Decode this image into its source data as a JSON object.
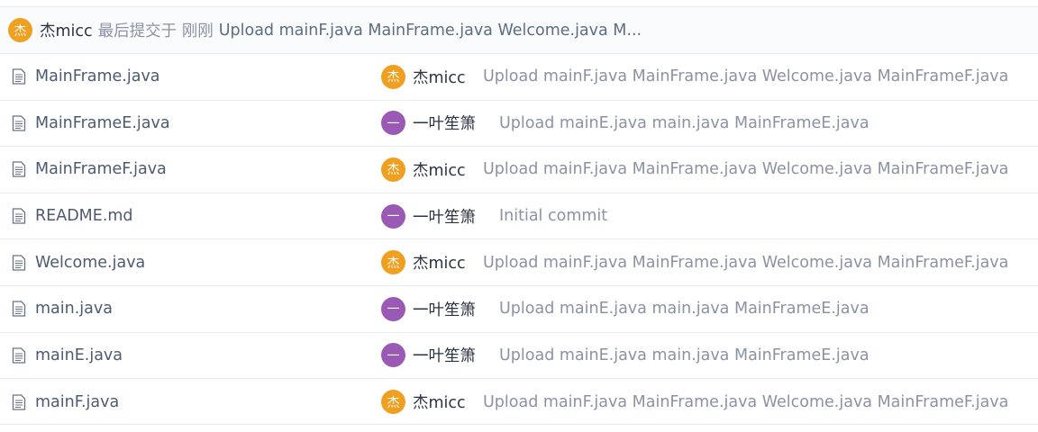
{
  "latest_commit": {
    "avatar_char": "杰",
    "author": "杰micc",
    "meta": "最后提交于 刚刚",
    "message": "Upload mainF.java MainFrame.java Welcome.java M..."
  },
  "files": [
    {
      "name": "MainFrame.java",
      "avatar_char": "杰",
      "author": "杰micc",
      "message": "Upload mainF.java MainFrame.java Welcome.java MainFrameF.java"
    },
    {
      "name": "MainFrameE.java",
      "avatar_char": "一",
      "author": "一叶笙箫",
      "message": "Upload mainE.java main.java MainFrameE.java"
    },
    {
      "name": "MainFrameF.java",
      "avatar_char": "杰",
      "author": "杰micc",
      "message": "Upload mainF.java MainFrame.java Welcome.java MainFrameF.java"
    },
    {
      "name": "README.md",
      "avatar_char": "一",
      "author": "一叶笙箫",
      "message": "Initial commit"
    },
    {
      "name": "Welcome.java",
      "avatar_char": "杰",
      "author": "杰micc",
      "message": "Upload mainF.java MainFrame.java Welcome.java MainFrameF.java"
    },
    {
      "name": "main.java",
      "avatar_char": "一",
      "author": "一叶笙箫",
      "message": "Upload mainE.java main.java MainFrameE.java"
    },
    {
      "name": "mainE.java",
      "avatar_char": "一",
      "author": "一叶笙箫",
      "message": "Upload mainE.java main.java MainFrameE.java"
    },
    {
      "name": "mainF.java",
      "avatar_char": "杰",
      "author": "杰micc",
      "message": "Upload mainF.java MainFrame.java Welcome.java MainFrameF.java"
    }
  ],
  "icons": {
    "file": "file-text-icon"
  },
  "colors": {
    "avatar_jie": "#f0a020",
    "avatar_yi": "#9b59b6",
    "link": "#4d5b72",
    "muted": "#8c92a4"
  }
}
